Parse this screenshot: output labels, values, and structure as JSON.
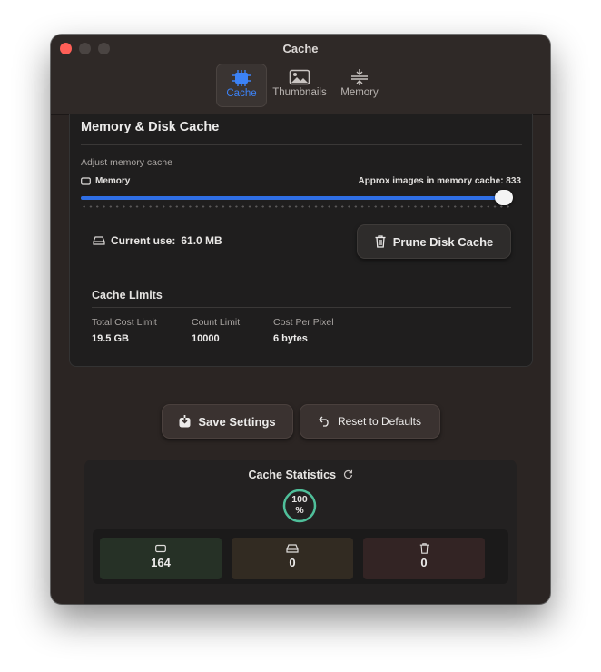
{
  "window": {
    "title": "Cache"
  },
  "tabs": [
    {
      "label": "Cache",
      "icon": "chip-icon",
      "active": true
    },
    {
      "label": "Thumbnails",
      "icon": "photo-icon",
      "active": false
    },
    {
      "label": "Memory",
      "icon": "compress-icon",
      "active": false
    }
  ],
  "panel": {
    "title": "Memory & Disk Cache",
    "adjust_label": "Adjust memory cache",
    "memory_label": "Memory",
    "approx_label": "Approx images in memory cache: 833",
    "slider_value": 0.98,
    "current_use_label": "Current use:",
    "current_use_value": "61.0 MB",
    "prune_label": "Prune Disk Cache",
    "limits": {
      "title": "Cache Limits",
      "items": [
        {
          "label": "Total Cost Limit",
          "value": "19.5 GB"
        },
        {
          "label": "Count Limit",
          "value": "10000"
        },
        {
          "label": "Cost Per Pixel",
          "value": "6 bytes"
        }
      ]
    }
  },
  "actions": {
    "save_label": "Save Settings",
    "reset_label": "Reset to Defaults"
  },
  "stats": {
    "title": "Cache Statistics",
    "gauge_value": "100",
    "gauge_unit": "%",
    "gauge_color": "#4fbf9a",
    "cards": [
      {
        "icon": "memory-icon",
        "value": "164",
        "color": "#263126"
      },
      {
        "icon": "disk-icon",
        "value": "0",
        "color": "#322b22"
      },
      {
        "icon": "trash-icon",
        "value": "0",
        "color": "#332424"
      }
    ]
  },
  "colors": {
    "accent": "#3c82f6",
    "close": "#ff5f57"
  }
}
